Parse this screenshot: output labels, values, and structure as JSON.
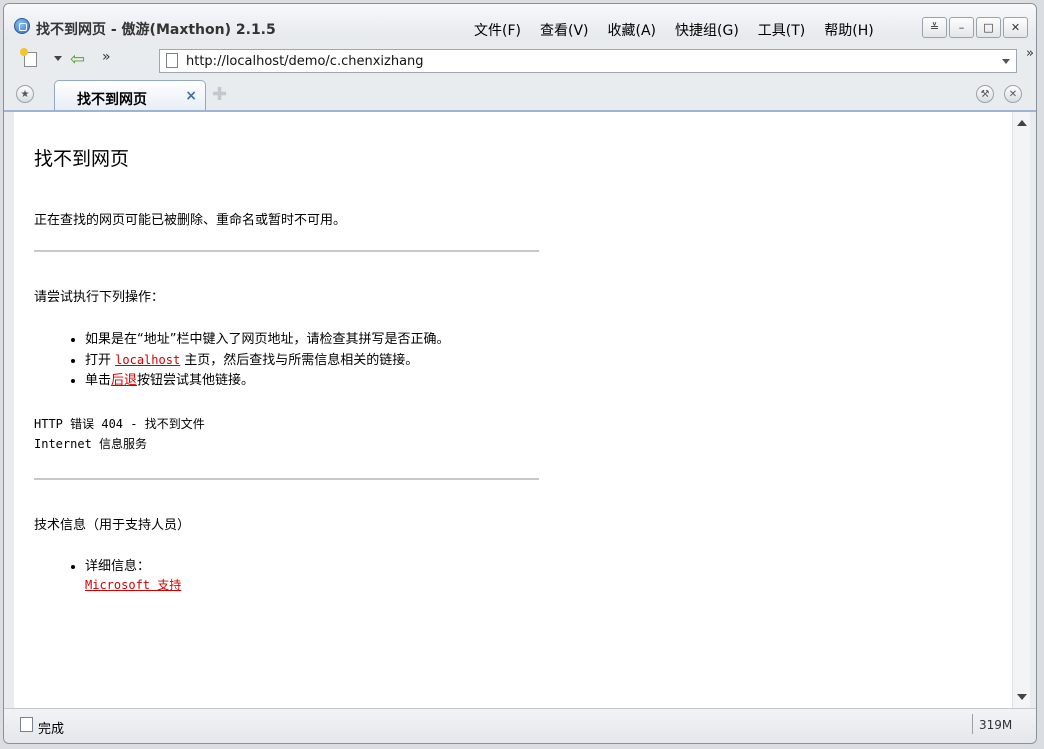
{
  "window": {
    "title": "找不到网页 - 傲游(Maxthon) 2.1.5"
  },
  "menu": {
    "items": [
      "文件(F)",
      "查看(V)",
      "收藏(A)",
      "快捷组(G)",
      "工具(T)",
      "帮助(H)"
    ]
  },
  "address": {
    "url": "http://localhost/demo/c.chenxizhang",
    "more_symbol": "»"
  },
  "tab": {
    "label": "找不到网页",
    "close_symbol": "×"
  },
  "page": {
    "heading": "找不到网页",
    "description": "正在查找的网页可能已被删除、重命名或暂时不可用。",
    "try_heading": "请尝试执行下列操作：",
    "items": {
      "item1": "如果是在“地址”栏中键入了网页地址，请检查其拼写是否正确。",
      "item2_prefix": "打开 ",
      "item2_link": "localhost",
      "item2_suffix": " 主页，然后查找与所需信息相关的链接。",
      "item3_prefix": "单击",
      "item3_link": "后退",
      "item3_suffix": "按钮尝试其他链接。"
    },
    "http_error": "HTTP 错误 404 - 找不到文件",
    "iis": "Internet 信息服务",
    "tech_heading": "技术信息（用于支持人员）",
    "details_label": "详细信息：",
    "support_link": "Microsoft 支持"
  },
  "status": {
    "text": "完成",
    "memory": "319M"
  }
}
